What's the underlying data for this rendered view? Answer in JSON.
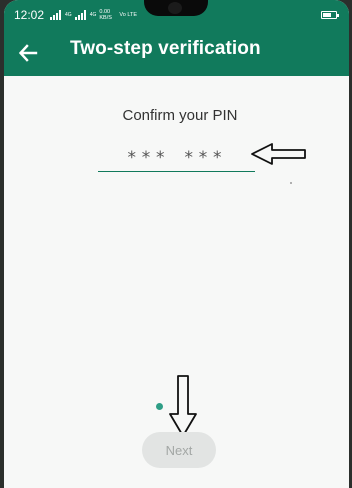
{
  "status_bar": {
    "time": "12:02",
    "net_tag_1": "4G",
    "net_tag_2": "4G",
    "speed": "0.00 KB/S",
    "volte": "Vo LTE",
    "icons": [
      "signal-icon",
      "signal-icon",
      "battery-icon"
    ]
  },
  "app_bar": {
    "back_icon": "arrow-left-icon",
    "title": "Two-step verification"
  },
  "main": {
    "prompt": "Confirm your PIN",
    "pin_value": "*** ***",
    "next_label": "Next"
  },
  "annotations": {
    "pointer_icons": [
      "hand-drawn-arrow-left-icon",
      "hand-drawn-arrow-down-icon"
    ]
  },
  "colors": {
    "brand": "#117a5c",
    "background": "#f7f8f7",
    "button_disabled_bg": "#e2e4e3",
    "button_disabled_text": "#a3a7a5",
    "dot": "#2e9e86"
  }
}
